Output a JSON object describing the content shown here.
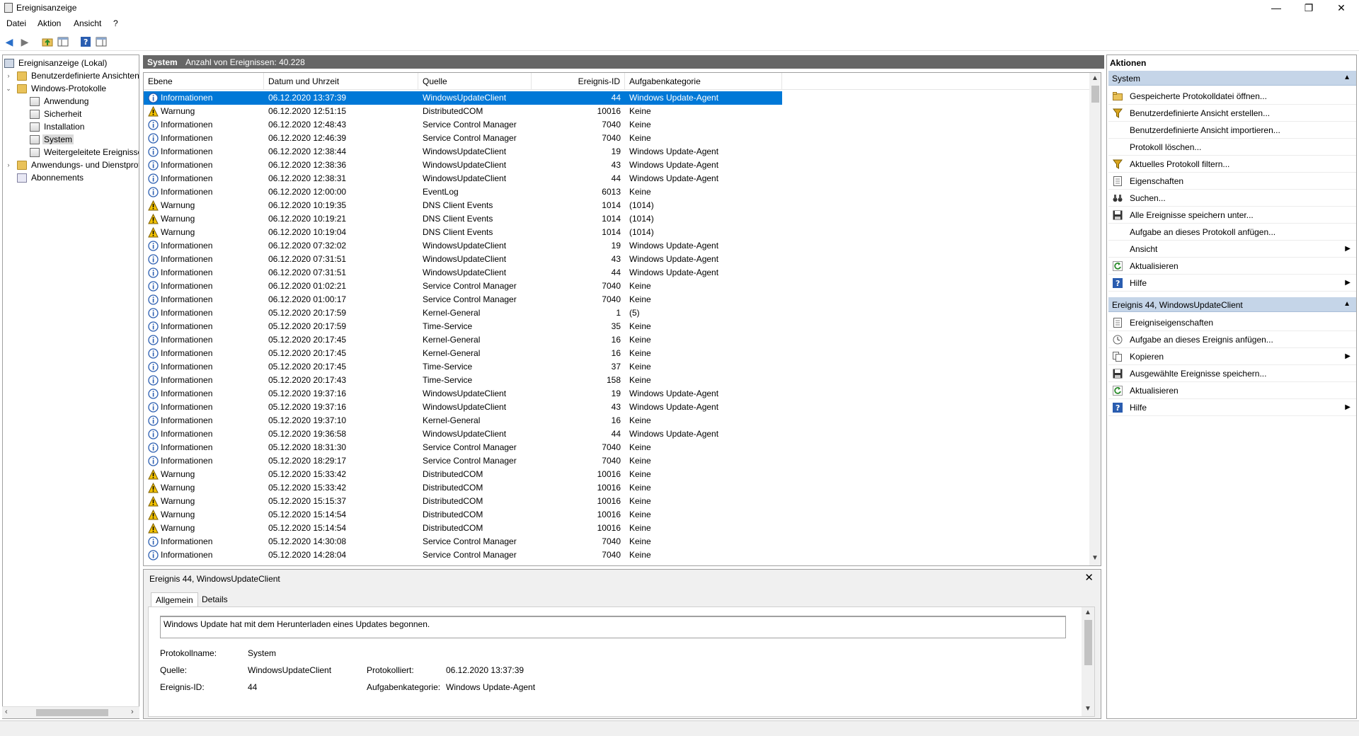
{
  "window": {
    "title": "Ereignisanzeige",
    "minimize_glyph": "—",
    "maximize_glyph": "❐",
    "close_glyph": "✕"
  },
  "menu": [
    {
      "label": "Datei"
    },
    {
      "label": "Aktion"
    },
    {
      "label": "Ansicht"
    },
    {
      "label": "?"
    }
  ],
  "toolbar": [
    "back-icon",
    "forward-icon",
    "up-folder-icon",
    "show-hide-console-tree-icon",
    "help-icon",
    "show-hide-action-pane-icon"
  ],
  "tree": [
    {
      "label": "Ereignisanzeige (Lokal)",
      "level": 0,
      "icon": "root"
    },
    {
      "label": "Benutzerdefinierte Ansichten",
      "level": 1,
      "icon": "folder",
      "expander": "›"
    },
    {
      "label": "Windows-Protokolle",
      "level": 1,
      "icon": "folder",
      "expander": "⌄"
    },
    {
      "label": "Anwendung",
      "level": 2,
      "icon": "log"
    },
    {
      "label": "Sicherheit",
      "level": 2,
      "icon": "log"
    },
    {
      "label": "Installation",
      "level": 2,
      "icon": "log"
    },
    {
      "label": "System",
      "level": 2,
      "icon": "log",
      "selected": true
    },
    {
      "label": "Weitergeleitete Ereignisse",
      "level": 2,
      "icon": "log"
    },
    {
      "label": "Anwendungs- und Dienstprotokolle",
      "level": 1,
      "icon": "folder",
      "expander": "›"
    },
    {
      "label": "Abonnements",
      "level": 1,
      "icon": "sub"
    }
  ],
  "center": {
    "log_name": "System",
    "event_count": "Anzahl von Ereignissen: 40.228",
    "columns": [
      "Ebene",
      "Datum und Uhrzeit",
      "Quelle",
      "Ereignis-ID",
      "Aufgabenkategorie"
    ],
    "rows": [
      {
        "level": "Informationen",
        "type": "info",
        "date": "06.12.2020 13:37:39",
        "source": "WindowsUpdateClient",
        "id": "44",
        "cat": "Windows Update-Agent",
        "selected": true
      },
      {
        "level": "Warnung",
        "type": "warn",
        "date": "06.12.2020 12:51:15",
        "source": "DistributedCOM",
        "id": "10016",
        "cat": "Keine"
      },
      {
        "level": "Informationen",
        "type": "info",
        "date": "06.12.2020 12:48:43",
        "source": "Service Control Manager",
        "id": "7040",
        "cat": "Keine"
      },
      {
        "level": "Informationen",
        "type": "info",
        "date": "06.12.2020 12:46:39",
        "source": "Service Control Manager",
        "id": "7040",
        "cat": "Keine"
      },
      {
        "level": "Informationen",
        "type": "info",
        "date": "06.12.2020 12:38:44",
        "source": "WindowsUpdateClient",
        "id": "19",
        "cat": "Windows Update-Agent"
      },
      {
        "level": "Informationen",
        "type": "info",
        "date": "06.12.2020 12:38:36",
        "source": "WindowsUpdateClient",
        "id": "43",
        "cat": "Windows Update-Agent"
      },
      {
        "level": "Informationen",
        "type": "info",
        "date": "06.12.2020 12:38:31",
        "source": "WindowsUpdateClient",
        "id": "44",
        "cat": "Windows Update-Agent"
      },
      {
        "level": "Informationen",
        "type": "info",
        "date": "06.12.2020 12:00:00",
        "source": "EventLog",
        "id": "6013",
        "cat": "Keine"
      },
      {
        "level": "Warnung",
        "type": "warn",
        "date": "06.12.2020 10:19:35",
        "source": "DNS Client Events",
        "id": "1014",
        "cat": "(1014)"
      },
      {
        "level": "Warnung",
        "type": "warn",
        "date": "06.12.2020 10:19:21",
        "source": "DNS Client Events",
        "id": "1014",
        "cat": "(1014)"
      },
      {
        "level": "Warnung",
        "type": "warn",
        "date": "06.12.2020 10:19:04",
        "source": "DNS Client Events",
        "id": "1014",
        "cat": "(1014)"
      },
      {
        "level": "Informationen",
        "type": "info",
        "date": "06.12.2020 07:32:02",
        "source": "WindowsUpdateClient",
        "id": "19",
        "cat": "Windows Update-Agent"
      },
      {
        "level": "Informationen",
        "type": "info",
        "date": "06.12.2020 07:31:51",
        "source": "WindowsUpdateClient",
        "id": "43",
        "cat": "Windows Update-Agent"
      },
      {
        "level": "Informationen",
        "type": "info",
        "date": "06.12.2020 07:31:51",
        "source": "WindowsUpdateClient",
        "id": "44",
        "cat": "Windows Update-Agent"
      },
      {
        "level": "Informationen",
        "type": "info",
        "date": "06.12.2020 01:02:21",
        "source": "Service Control Manager",
        "id": "7040",
        "cat": "Keine"
      },
      {
        "level": "Informationen",
        "type": "info",
        "date": "06.12.2020 01:00:17",
        "source": "Service Control Manager",
        "id": "7040",
        "cat": "Keine"
      },
      {
        "level": "Informationen",
        "type": "info",
        "date": "05.12.2020 20:17:59",
        "source": "Kernel-General",
        "id": "1",
        "cat": "(5)"
      },
      {
        "level": "Informationen",
        "type": "info",
        "date": "05.12.2020 20:17:59",
        "source": "Time-Service",
        "id": "35",
        "cat": "Keine"
      },
      {
        "level": "Informationen",
        "type": "info",
        "date": "05.12.2020 20:17:45",
        "source": "Kernel-General",
        "id": "16",
        "cat": "Keine"
      },
      {
        "level": "Informationen",
        "type": "info",
        "date": "05.12.2020 20:17:45",
        "source": "Kernel-General",
        "id": "16",
        "cat": "Keine"
      },
      {
        "level": "Informationen",
        "type": "info",
        "date": "05.12.2020 20:17:45",
        "source": "Time-Service",
        "id": "37",
        "cat": "Keine"
      },
      {
        "level": "Informationen",
        "type": "info",
        "date": "05.12.2020 20:17:43",
        "source": "Time-Service",
        "id": "158",
        "cat": "Keine"
      },
      {
        "level": "Informationen",
        "type": "info",
        "date": "05.12.2020 19:37:16",
        "source": "WindowsUpdateClient",
        "id": "19",
        "cat": "Windows Update-Agent"
      },
      {
        "level": "Informationen",
        "type": "info",
        "date": "05.12.2020 19:37:16",
        "source": "WindowsUpdateClient",
        "id": "43",
        "cat": "Windows Update-Agent"
      },
      {
        "level": "Informationen",
        "type": "info",
        "date": "05.12.2020 19:37:10",
        "source": "Kernel-General",
        "id": "16",
        "cat": "Keine"
      },
      {
        "level": "Informationen",
        "type": "info",
        "date": "05.12.2020 19:36:58",
        "source": "WindowsUpdateClient",
        "id": "44",
        "cat": "Windows Update-Agent"
      },
      {
        "level": "Informationen",
        "type": "info",
        "date": "05.12.2020 18:31:30",
        "source": "Service Control Manager",
        "id": "7040",
        "cat": "Keine"
      },
      {
        "level": "Informationen",
        "type": "info",
        "date": "05.12.2020 18:29:17",
        "source": "Service Control Manager",
        "id": "7040",
        "cat": "Keine"
      },
      {
        "level": "Warnung",
        "type": "warn",
        "date": "05.12.2020 15:33:42",
        "source": "DistributedCOM",
        "id": "10016",
        "cat": "Keine"
      },
      {
        "level": "Warnung",
        "type": "warn",
        "date": "05.12.2020 15:33:42",
        "source": "DistributedCOM",
        "id": "10016",
        "cat": "Keine"
      },
      {
        "level": "Warnung",
        "type": "warn",
        "date": "05.12.2020 15:15:37",
        "source": "DistributedCOM",
        "id": "10016",
        "cat": "Keine"
      },
      {
        "level": "Warnung",
        "type": "warn",
        "date": "05.12.2020 15:14:54",
        "source": "DistributedCOM",
        "id": "10016",
        "cat": "Keine"
      },
      {
        "level": "Warnung",
        "type": "warn",
        "date": "05.12.2020 15:14:54",
        "source": "DistributedCOM",
        "id": "10016",
        "cat": "Keine"
      },
      {
        "level": "Informationen",
        "type": "info",
        "date": "05.12.2020 14:30:08",
        "source": "Service Control Manager",
        "id": "7040",
        "cat": "Keine"
      },
      {
        "level": "Informationen",
        "type": "info",
        "date": "05.12.2020 14:28:04",
        "source": "Service Control Manager",
        "id": "7040",
        "cat": "Keine"
      }
    ]
  },
  "detail": {
    "title": "Ereignis 44, WindowsUpdateClient",
    "close": "✕",
    "tabs": [
      "Allgemein",
      "Details"
    ],
    "message": "Windows Update hat mit dem Herunterladen eines Updates begonnen.",
    "fields": {
      "logname_label": "Protokollname:",
      "logname": "System",
      "source_label": "Quelle:",
      "source": "WindowsUpdateClient",
      "logged_label": "Protokolliert:",
      "logged": "06.12.2020 13:37:39",
      "eventid_label": "Ereignis-ID:",
      "eventid": "44",
      "taskcat_label": "Aufgabenkategorie:",
      "taskcat": "Windows Update-Agent"
    }
  },
  "actions": {
    "header": "Aktionen",
    "sections": [
      {
        "title": "System",
        "items": [
          {
            "label": "Gespeicherte Protokolldatei öffnen...",
            "icon": "open-folder-icon"
          },
          {
            "label": "Benutzerdefinierte Ansicht erstellen...",
            "icon": "filter-icon"
          },
          {
            "label": "Benutzerdefinierte Ansicht importieren...",
            "icon": ""
          },
          {
            "label": "Protokoll löschen...",
            "icon": ""
          },
          {
            "label": "Aktuelles Protokoll filtern...",
            "icon": "filter-icon"
          },
          {
            "label": "Eigenschaften",
            "icon": "properties-icon"
          },
          {
            "label": "Suchen...",
            "icon": "binoculars-icon"
          },
          {
            "label": "Alle Ereignisse speichern unter...",
            "icon": "save-icon"
          },
          {
            "label": "Aufgabe an dieses Protokoll anfügen...",
            "icon": ""
          },
          {
            "label": "Ansicht",
            "icon": "",
            "submenu": true
          },
          {
            "label": "Aktualisieren",
            "icon": "refresh-icon"
          },
          {
            "label": "Hilfe",
            "icon": "help-icon",
            "submenu": true
          }
        ]
      },
      {
        "title": "Ereignis 44, WindowsUpdateClient",
        "items": [
          {
            "label": "Ereigniseigenschaften",
            "icon": "properties-icon"
          },
          {
            "label": "Aufgabe an dieses Ereignis anfügen...",
            "icon": "task-icon"
          },
          {
            "label": "Kopieren",
            "icon": "copy-icon",
            "submenu": true
          },
          {
            "label": "Ausgewählte Ereignisse speichern...",
            "icon": "save-icon"
          },
          {
            "label": "Aktualisieren",
            "icon": "refresh-icon"
          },
          {
            "label": "Hilfe",
            "icon": "help-icon",
            "submenu": true
          }
        ]
      }
    ]
  },
  "colors": {
    "accent": "#0078d7",
    "section": "#c5d5e8",
    "header_bar": "#666666"
  }
}
